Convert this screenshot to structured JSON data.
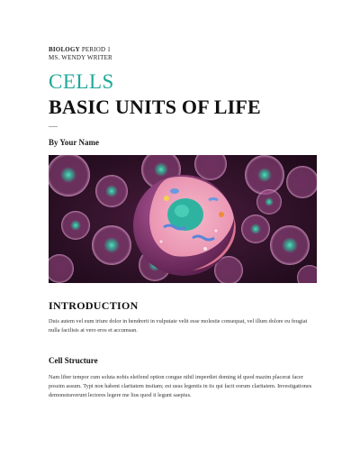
{
  "header": {
    "course_bold": "BIOLOGY",
    "course_rest": "PERIOD 1",
    "teacher": "MS. WENDY WRITER"
  },
  "title": {
    "accent_word": "CELLS",
    "subtitle": "BASIC UNITS OF LIFE"
  },
  "author": "By Your Name",
  "hero": {
    "icon": "cell-cross-section-illustration",
    "colors": {
      "background": "#2a1024",
      "glow": "#3fd6b4",
      "membrane": "#e79ab8",
      "nucleus": "#2fb3a0"
    }
  },
  "sections": {
    "intro": {
      "heading": "INTRODUCTION",
      "text": "Duis autem vel eum iriure dolor in hendrerit in vulputate velit esse molestie consequat, vel illum dolore eu feugiat nulla facilisis at vero eros et accumsan."
    },
    "cell_structure": {
      "heading": "Cell Structure",
      "text": "Nam liber tempor cum soluta nobis eleifend option congue nihil imperdiet doming id quod mazim placerat facer possim assum. Typi non habent claritatem insitam; est usus legentis in iis qui facit eorum claritatem. Investigationes demonstraverunt lectores legere me lius quod ii legunt saepius."
    }
  },
  "accent_color": "#1fa89a"
}
